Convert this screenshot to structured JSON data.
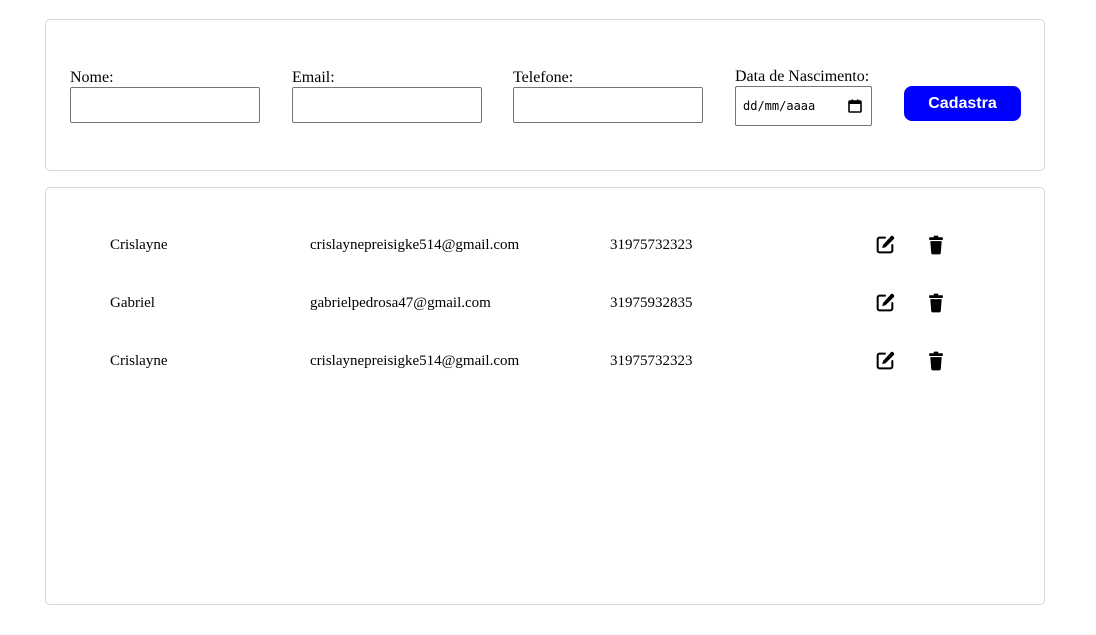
{
  "form": {
    "nome_label": "Nome:",
    "nome_value": "",
    "email_label": "Email:",
    "email_value": "",
    "telefone_label": "Telefone:",
    "telefone_value": "",
    "nascimento_label": "Data de Nascimento:",
    "nascimento_placeholder": "dd/mm/aaaa",
    "submit_label": "Cadastra",
    "submit_color": "#0000ff"
  },
  "users": {
    "rows": [
      {
        "name": "Crislayne",
        "email": "crislaynepreisigke514@gmail.com",
        "phone": "31975732323",
        "edit_icon": "edit-icon",
        "delete_icon": "trash-icon"
      },
      {
        "name": "Gabriel",
        "email": "gabrielpedrosa47@gmail.com",
        "phone": "31975932835",
        "edit_icon": "edit-icon",
        "delete_icon": "trash-icon"
      },
      {
        "name": "Crislayne",
        "email": "crislaynepreisigke514@gmail.com",
        "phone": "31975732323",
        "edit_icon": "edit-icon",
        "delete_icon": "trash-icon"
      }
    ]
  }
}
